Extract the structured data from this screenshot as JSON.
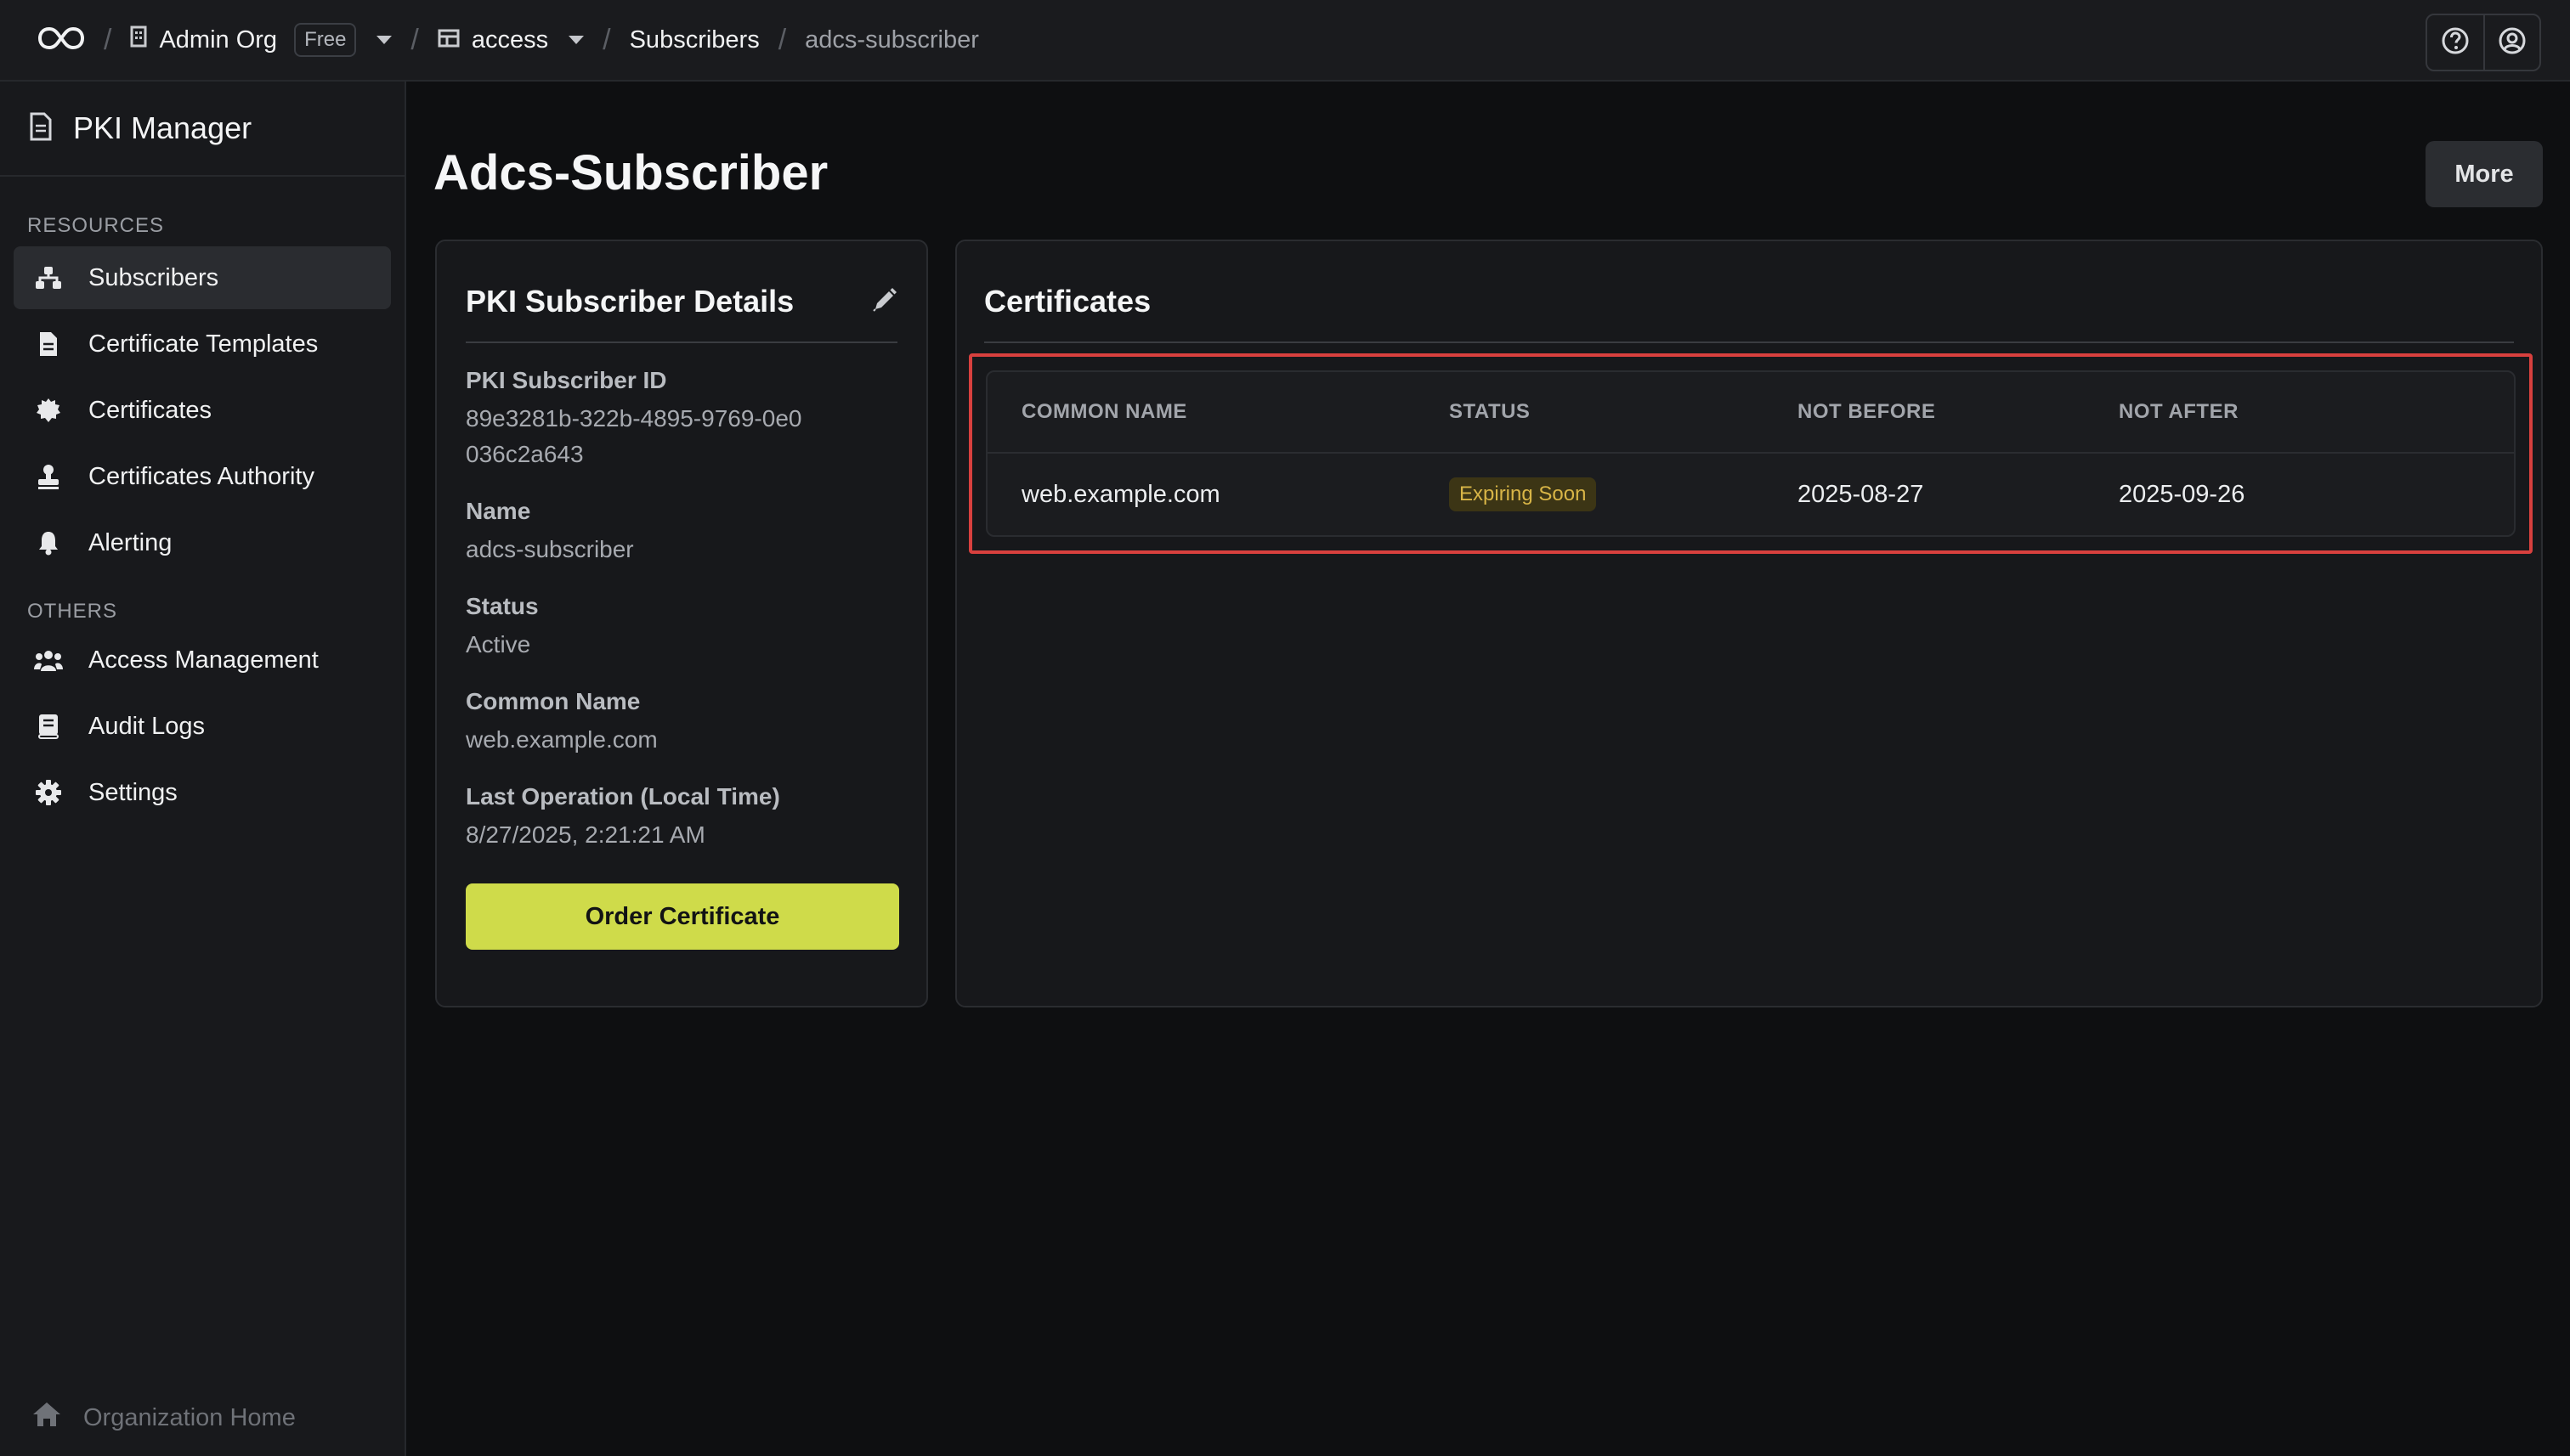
{
  "topbar": {
    "org_name": "Admin Org",
    "plan_badge": "Free",
    "project_name": "access",
    "crumb_subscribers": "Subscribers",
    "crumb_current": "adcs-subscriber",
    "separator": "/"
  },
  "sidebar": {
    "brand": "PKI Manager",
    "resources_label": "RESOURCES",
    "resources": [
      {
        "label": "Subscribers",
        "icon": "sitemap-icon"
      },
      {
        "label": "Certificate Templates",
        "icon": "document-icon"
      },
      {
        "label": "Certificates",
        "icon": "certificate-badge-icon"
      },
      {
        "label": "Certificates Authority",
        "icon": "stamp-icon"
      },
      {
        "label": "Alerting",
        "icon": "bell-icon"
      }
    ],
    "others_label": "OTHERS",
    "others": [
      {
        "label": "Access Management",
        "icon": "users-icon"
      },
      {
        "label": "Audit Logs",
        "icon": "book-icon"
      },
      {
        "label": "Settings",
        "icon": "gear-icon"
      }
    ],
    "org_home": "Organization Home"
  },
  "page": {
    "title": "Adcs-Subscriber",
    "more_label": "More"
  },
  "details": {
    "title": "PKI Subscriber Details",
    "fields": [
      {
        "label": "PKI Subscriber ID",
        "value": "89e3281b-322b-4895-9769-0e0036c2a643"
      },
      {
        "label": "Name",
        "value": "adcs-subscriber"
      },
      {
        "label": "Status",
        "value": "Active"
      },
      {
        "label": "Common Name",
        "value": "web.example.com"
      },
      {
        "label": "Last Operation (Local Time)",
        "value": "8/27/2025, 2:21:21 AM"
      }
    ],
    "order_button": "Order Certificate"
  },
  "certificates": {
    "title": "Certificates",
    "columns": [
      "COMMON NAME",
      "STATUS",
      "NOT BEFORE",
      "NOT AFTER"
    ],
    "rows": [
      {
        "common_name": "web.example.com",
        "status": "Expiring Soon",
        "not_before": "2025-08-27",
        "not_after": "2025-09-26"
      }
    ]
  },
  "colors": {
    "accent": "#cfdb4a",
    "highlight": "#d8403e",
    "warning_text": "#d8b547"
  }
}
